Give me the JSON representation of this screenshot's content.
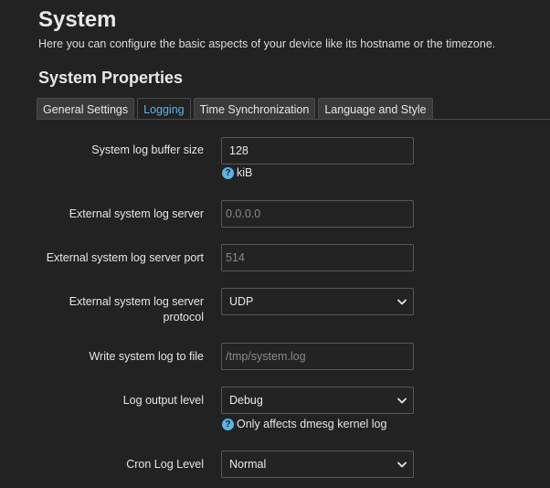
{
  "header": {
    "title": "System",
    "description": "Here you can configure the basic aspects of your device like its hostname or the timezone."
  },
  "section": {
    "title": "System Properties"
  },
  "tabs": [
    {
      "label": "General Settings",
      "active": false
    },
    {
      "label": "Logging",
      "active": true
    },
    {
      "label": "Time Synchronization",
      "active": false
    },
    {
      "label": "Language and Style",
      "active": false
    }
  ],
  "form": {
    "log_buffer": {
      "label": "System log buffer size",
      "value": "128",
      "help": "kiB"
    },
    "log_server": {
      "label": "External system log server",
      "placeholder": "0.0.0.0"
    },
    "log_server_port": {
      "label": "External system log server port",
      "placeholder": "514"
    },
    "log_protocol": {
      "label_line1": "External system log server",
      "label_line2": "protocol",
      "value": "UDP"
    },
    "log_file": {
      "label": "Write system log to file",
      "placeholder": "/tmp/system.log"
    },
    "log_level": {
      "label": "Log output level",
      "value": "Debug",
      "help": "Only affects dmesg kernel log"
    },
    "cron_level": {
      "label": "Cron Log Level",
      "value": "Normal"
    }
  },
  "colors": {
    "background": "#222222",
    "accent": "#5ab4e6",
    "field_border": "#585858"
  },
  "icons": {
    "help": "question-circle-icon",
    "select": "chevron-down-icon"
  }
}
